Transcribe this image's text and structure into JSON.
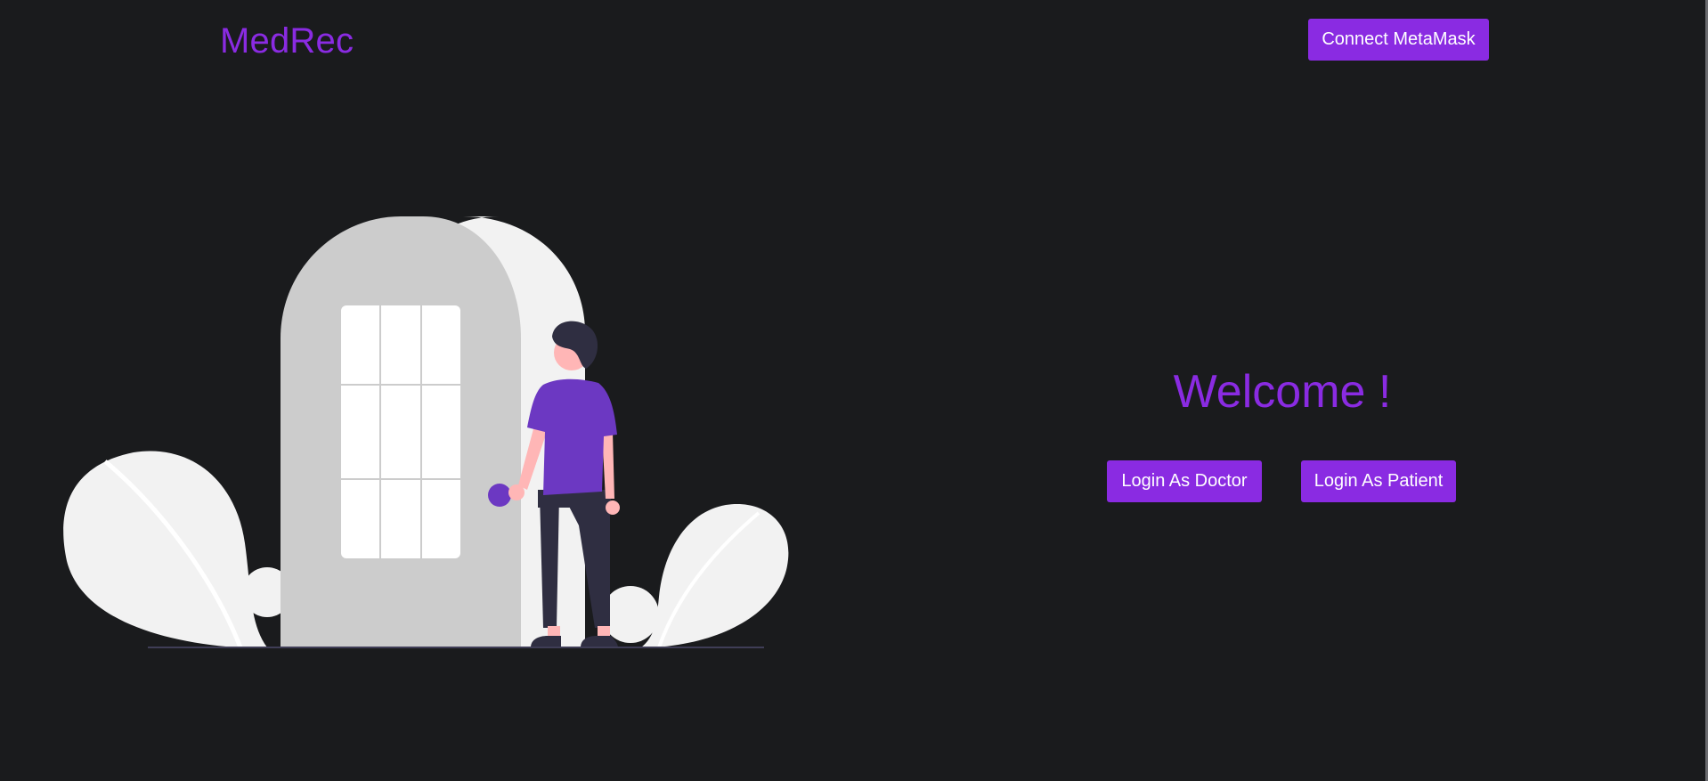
{
  "header": {
    "brand": "MedRec",
    "connect_label": "Connect MetaMask"
  },
  "hero": {
    "welcome_text": "Welcome !",
    "login_doctor_label": "Login As Doctor",
    "login_patient_label": "Login As Patient"
  },
  "colors": {
    "background": "#1a1b1d",
    "accent": "#8a2be2",
    "button_text": "#ffffff",
    "illustration_door": "#cccccc",
    "illustration_wall": "#f2f2f2",
    "illustration_shirt": "#6c38c2",
    "illustration_pants": "#2f2e41",
    "illustration_skin": "#ffb6b6"
  },
  "illustration": {
    "name": "person-at-door-illustration"
  }
}
